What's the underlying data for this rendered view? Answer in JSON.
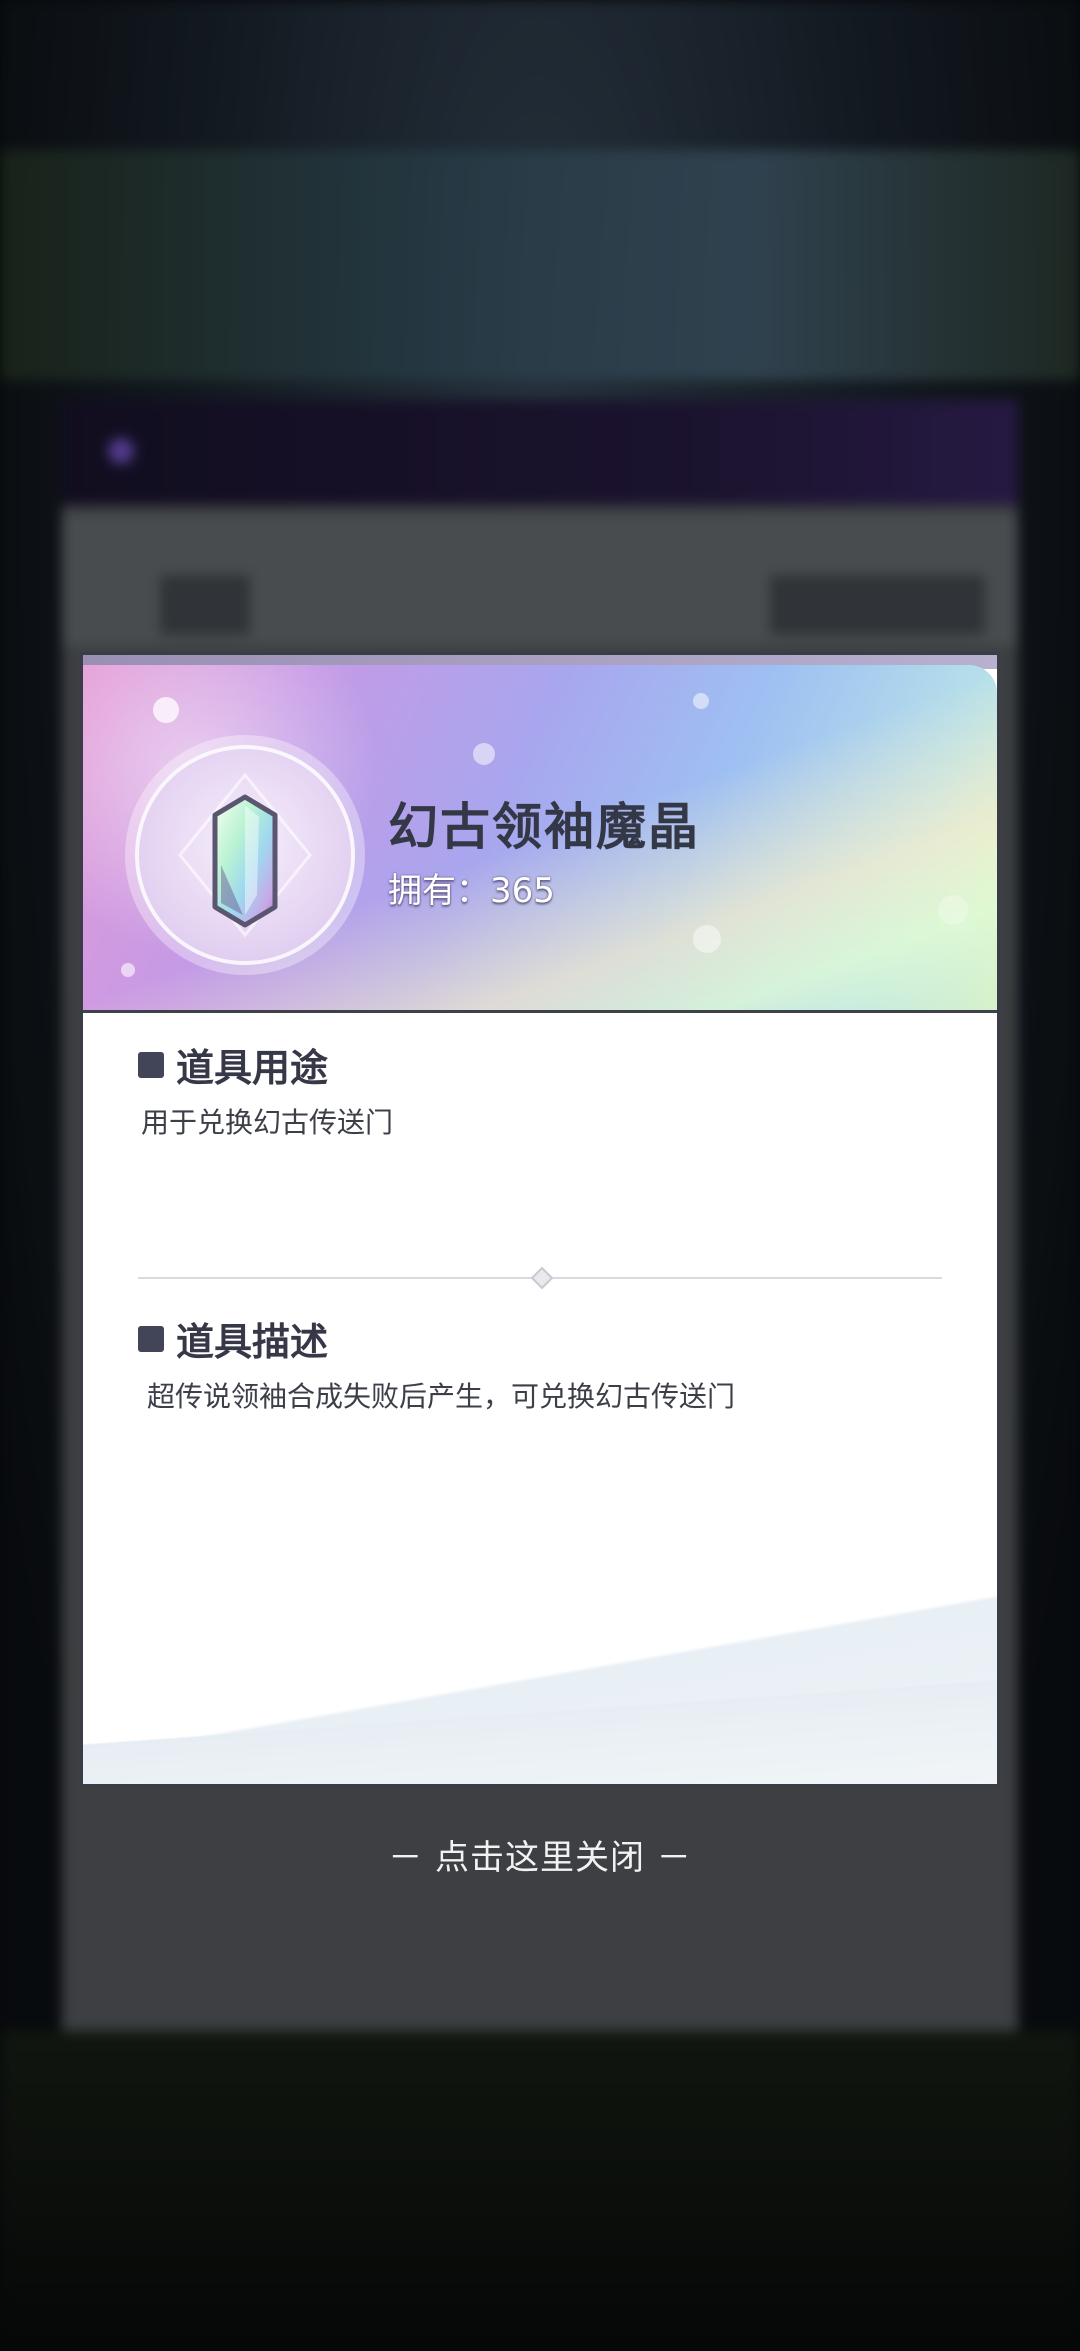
{
  "item": {
    "name": "幻古领袖魔晶",
    "owned_label": "拥有：",
    "owned_count": "365",
    "icon": "crystal-icon"
  },
  "usage": {
    "title": "道具用途",
    "text": "用于兑换幻古传送门"
  },
  "description": {
    "title": "道具描述",
    "text": "超传说领袖合成失败后产生，可兑换幻古传送门"
  },
  "close_hint": "－ 点击这里关闭 －",
  "colors": {
    "title_text": "#363847",
    "overlay": "rgba(0,0,0,0.35)",
    "header_gradient_start": "#e59ad6",
    "header_gradient_end": "#d6f2c9"
  }
}
